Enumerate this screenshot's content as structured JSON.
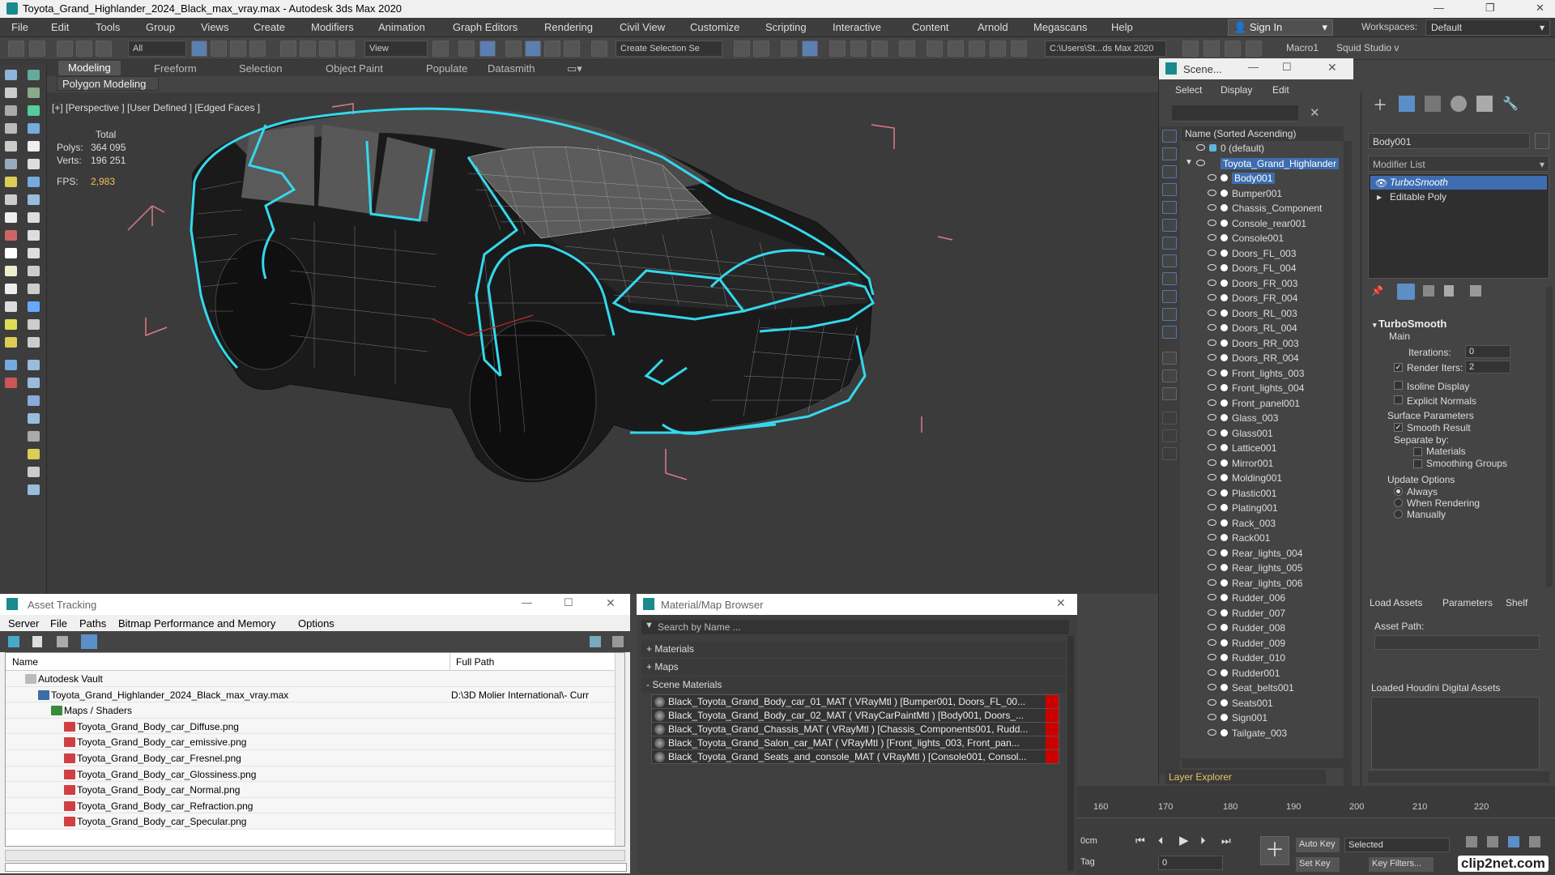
{
  "window": {
    "title": "Toyota_Grand_Highlander_2024_Black_max_vray.max - Autodesk 3ds Max 2020"
  },
  "menu": [
    "File",
    "Edit",
    "Tools",
    "Group",
    "Views",
    "Create",
    "Modifiers",
    "Animation",
    "Graph Editors",
    "Rendering",
    "Civil View",
    "Customize",
    "Scripting",
    "Interactive",
    "Content",
    "Arnold",
    "Megascans",
    "Help"
  ],
  "account": {
    "sign_in": "Sign In",
    "workspaces_label": "Workspaces:",
    "workspace_value": "Default"
  },
  "toolbar": {
    "selection_filter": "All",
    "ref_coord": "View",
    "named_selection": "Create Selection Se",
    "project_path": "C:\\Users\\St...ds Max 2020",
    "macro": "Macro1",
    "squid": "Squid Studio v"
  },
  "ribbon": {
    "tabs": [
      "Modeling",
      "Freeform",
      "Selection",
      "Object Paint",
      "Populate",
      "Datasmith"
    ],
    "active": "Modeling",
    "sub_tab": "Polygon Modeling"
  },
  "viewport": {
    "label": "[+] [Perspective ] [User Defined ] [Edged Faces ]",
    "stats": {
      "total_label": "Total",
      "polys_label": "Polys:",
      "polys_value": "364 095",
      "verts_label": "Verts:",
      "verts_value": "196 251",
      "fps_label": "FPS:",
      "fps_value": "2,983"
    }
  },
  "scene_explorer": {
    "title": "Scene...",
    "menu": [
      "Select",
      "Display",
      "Edit"
    ],
    "column_header": "Name (Sorted Ascending)",
    "root_layer": "0 (default)",
    "root_object": "Toyota_Grand_Highlander",
    "objects": [
      "Body001",
      "Bumper001",
      "Chassis_Component",
      "Console_rear001",
      "Console001",
      "Doors_FL_003",
      "Doors_FL_004",
      "Doors_FR_003",
      "Doors_FR_004",
      "Doors_RL_003",
      "Doors_RL_004",
      "Doors_RR_003",
      "Doors_RR_004",
      "Front_lights_003",
      "Front_lights_004",
      "Front_panel001",
      "Glass_003",
      "Glass001",
      "Lattice001",
      "Mirror001",
      "Molding001",
      "Plastic001",
      "Plating001",
      "Rack_003",
      "Rack001",
      "Rear_lights_004",
      "Rear_lights_005",
      "Rear_lights_006",
      "Rudder_006",
      "Rudder_007",
      "Rudder_008",
      "Rudder_009",
      "Rudder_010",
      "Rudder001",
      "Seat_belts001",
      "Seats001",
      "Sign001",
      "Tailgate_003"
    ],
    "selected": "Body001",
    "layer_explorer": "Layer Explorer"
  },
  "command_panel": {
    "object_name": "Body001",
    "modifier_list": "Modifier List",
    "stack": [
      "TurboSmooth",
      "Editable Poly"
    ],
    "turbosmooth": {
      "title": "TurboSmooth",
      "main": "Main",
      "iterations_label": "Iterations:",
      "iterations_value": "0",
      "render_iters_label": "Render Iters:",
      "render_iters_value": "2",
      "render_iters_checked": true,
      "isoline_display": "Isoline Display",
      "explicit_normals": "Explicit Normals",
      "surface_parameters": "Surface Parameters",
      "smooth_result": "Smooth Result",
      "smooth_result_checked": true,
      "separate_by": "Separate by:",
      "materials": "Materials",
      "smoothing_groups": "Smoothing Groups",
      "update_options": "Update Options",
      "always": "Always",
      "when_rendering": "When Rendering",
      "manually": "Manually",
      "update_selected": "Always"
    }
  },
  "assets_panel": {
    "tabs": [
      "Load Assets",
      "Parameters",
      "Shelf"
    ],
    "asset_path_label": "Asset Path:",
    "loaded_label": "Loaded Houdini Digital Assets"
  },
  "asset_tracking": {
    "title": "Asset Tracking",
    "menu": [
      "Server",
      "File",
      "Paths",
      "Bitmap Performance and Memory",
      "Options"
    ],
    "columns": [
      "Name",
      "Full Path"
    ],
    "rows": [
      {
        "name": "Autodesk Vault",
        "path": "",
        "indent": 0
      },
      {
        "name": "Toyota_Grand_Highlander_2024_Black_max_vray.max",
        "path": "D:\\3D Molier International\\- Curr",
        "indent": 1
      },
      {
        "name": "Maps / Shaders",
        "path": "",
        "indent": 2
      },
      {
        "name": "Toyota_Grand_Body_car_Diffuse.png",
        "path": "",
        "indent": 3
      },
      {
        "name": "Toyota_Grand_Body_car_emissive.png",
        "path": "",
        "indent": 3
      },
      {
        "name": "Toyota_Grand_Body_car_Fresnel.png",
        "path": "",
        "indent": 3
      },
      {
        "name": "Toyota_Grand_Body_car_Glossiness.png",
        "path": "",
        "indent": 3
      },
      {
        "name": "Toyota_Grand_Body_car_Normal.png",
        "path": "",
        "indent": 3
      },
      {
        "name": "Toyota_Grand_Body_car_Refraction.png",
        "path": "",
        "indent": 3
      },
      {
        "name": "Toyota_Grand_Body_car_Specular.png",
        "path": "",
        "indent": 3
      }
    ]
  },
  "material_browser": {
    "title": "Material/Map Browser",
    "search_placeholder": "Search by Name ...",
    "groups": [
      "+ Materials",
      "+ Maps",
      "- Scene Materials"
    ],
    "materials": [
      "Black_Toyota_Grand_Body_car_01_MAT ( VRayMtl ) [Bumper001, Doors_FL_00...",
      "Black_Toyota_Grand_Body_car_02_MAT ( VRayCarPaintMtl ) [Body001, Doors_...",
      "Black_Toyota_Grand_Chassis_MAT ( VRayMtl ) [Chassis_Components001, Rudd...",
      "Black_Toyota_Grand_Salon_car_MAT ( VRayMtl ) [Front_lights_003, Front_pan...",
      "Black_Toyota_Grand_Seats_and_console_MAT ( VRayMtl ) [Console001, Consol..."
    ]
  },
  "timeline": {
    "ticks": [
      "160",
      "170",
      "180",
      "190",
      "200",
      "210",
      "220"
    ],
    "auto_key": "Auto Key",
    "selected": "Selected",
    "set_key": "Set Key",
    "key_filters": "Key Filters...",
    "frame": "0",
    "tag": "Tag",
    "cm": "0cm"
  },
  "watermark": "clip2net.com",
  "colors": {
    "accent": "#3d6db0",
    "wire_highlight": "#34d8ec",
    "stat_value": "#f0c060",
    "layer_explorer": "#e8c26a"
  }
}
